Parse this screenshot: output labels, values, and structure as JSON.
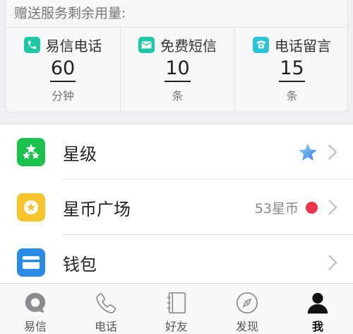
{
  "quota": {
    "title": "赠送服务剩余用量:",
    "items": [
      {
        "label": "易信电话",
        "value": "60",
        "unit": "分钟",
        "icon": "phone-icon",
        "color": "#1cc8a1"
      },
      {
        "label": "免费短信",
        "value": "10",
        "unit": "条",
        "icon": "message-icon",
        "color": "#1cc8a1"
      },
      {
        "label": "电话留言",
        "value": "15",
        "unit": "条",
        "icon": "voicemail-phone-icon",
        "color": "#29c4d6"
      }
    ]
  },
  "menu": {
    "items": [
      {
        "label": "星级",
        "icon": "stars-icon",
        "color": "#19c24d",
        "badge": "blue-star-icon"
      },
      {
        "label": "星币广场",
        "icon": "star-coin-icon",
        "color": "#f7c42b",
        "extra_text": "53星币",
        "dot_color": "#f0344d"
      },
      {
        "label": "钱包",
        "icon": "wallet-icon",
        "color": "#2b8ce8"
      }
    ]
  },
  "tabbar": {
    "tabs": [
      {
        "label": "易信",
        "icon": "yixin-logo-icon"
      },
      {
        "label": "电话",
        "icon": "phone-handset-icon"
      },
      {
        "label": "好友",
        "icon": "contacts-book-icon"
      },
      {
        "label": "发现",
        "icon": "compass-icon"
      },
      {
        "label": "我",
        "icon": "person-icon",
        "active": true
      }
    ]
  }
}
